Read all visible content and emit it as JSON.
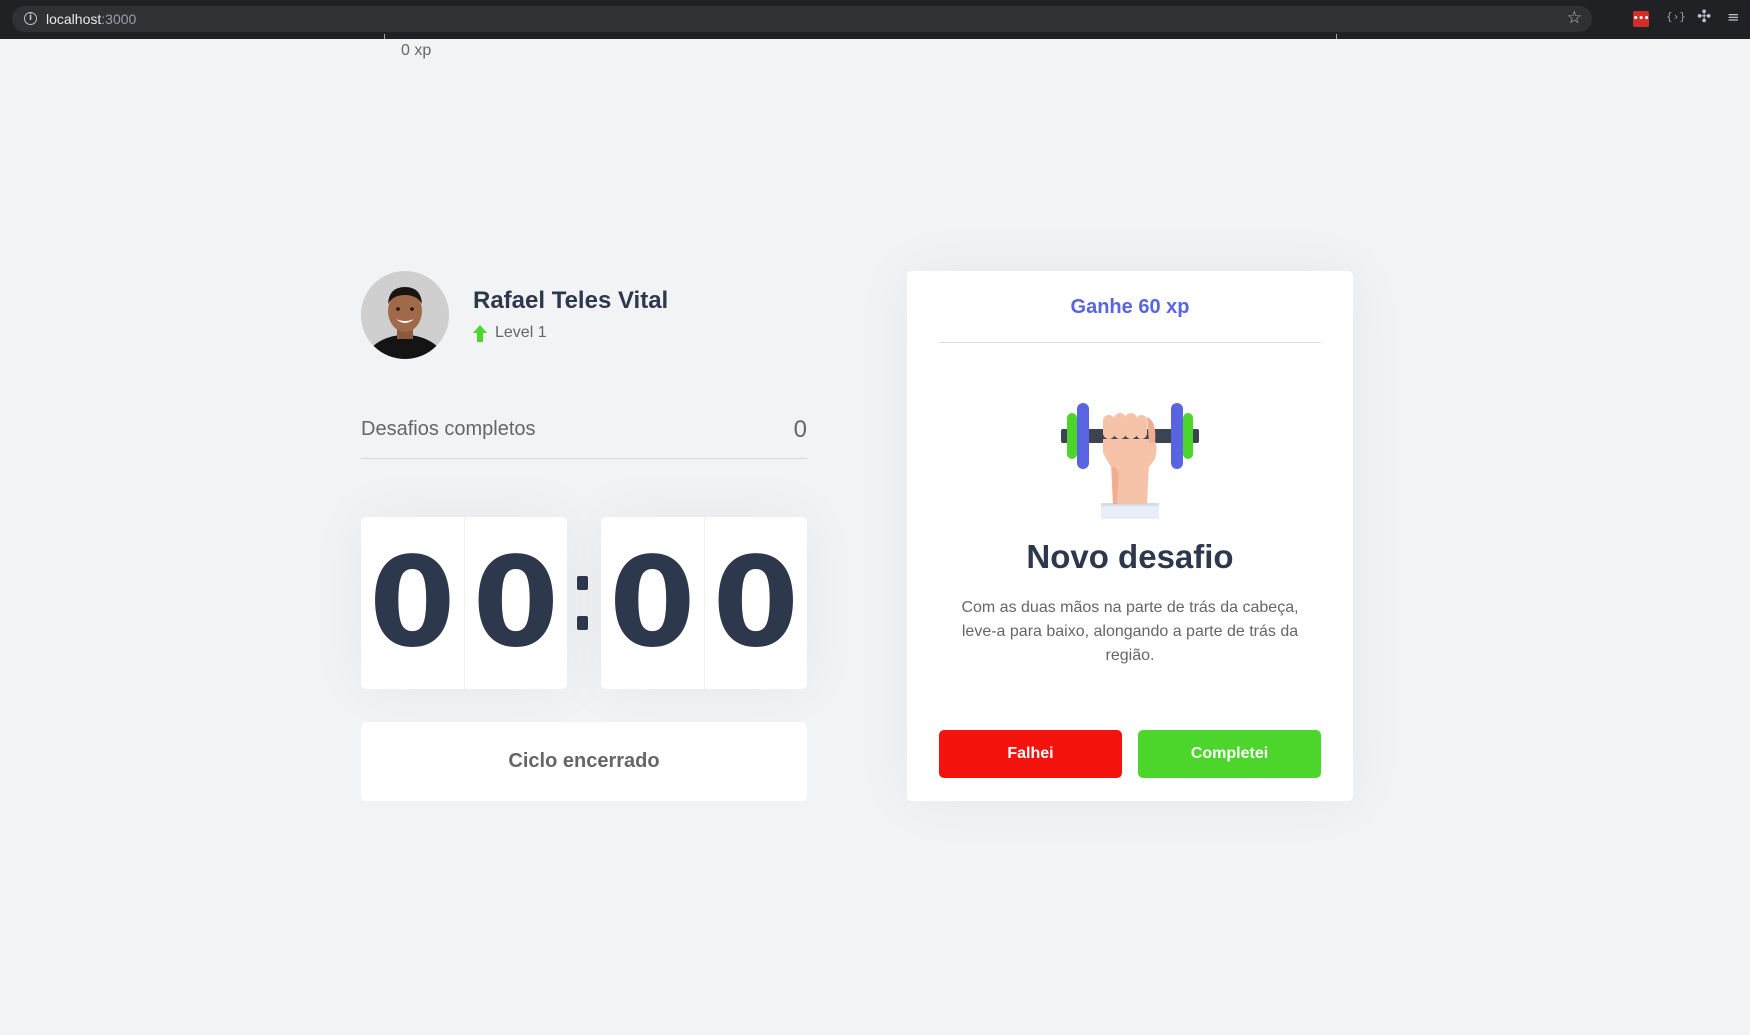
{
  "browser": {
    "url_host": "localhost",
    "url_port": ":3000"
  },
  "experience": {
    "current": "0 xp"
  },
  "profile": {
    "name": "Rafael Teles Vital",
    "level": "Level 1"
  },
  "stats": {
    "completed_label": "Desafios completos",
    "completed_value": "0"
  },
  "countdown": {
    "minute_left": "0",
    "minute_right": "0",
    "second_left": "0",
    "second_right": "0",
    "button_label": "Ciclo encerrado"
  },
  "challenge": {
    "reward": "Ganhe 60 xp",
    "title": "Novo desafio",
    "description": "Com as duas mãos na parte de trás da cabeça, leve-a para baixo, alongando a parte de trás da região.",
    "fail_label": "Falhei",
    "success_label": "Completei"
  },
  "colors": {
    "background": "#f2f3f5",
    "card": "#ffffff",
    "text_title": "#2e384d",
    "text": "#666666",
    "blue": "#5965e0",
    "red": "#f5130d",
    "green": "#4cd62b"
  },
  "icons": {
    "info": "info-icon",
    "bookmark": "star-icon",
    "level": "level-up-arrow-icon",
    "challenge": "dumbbell-icon"
  }
}
